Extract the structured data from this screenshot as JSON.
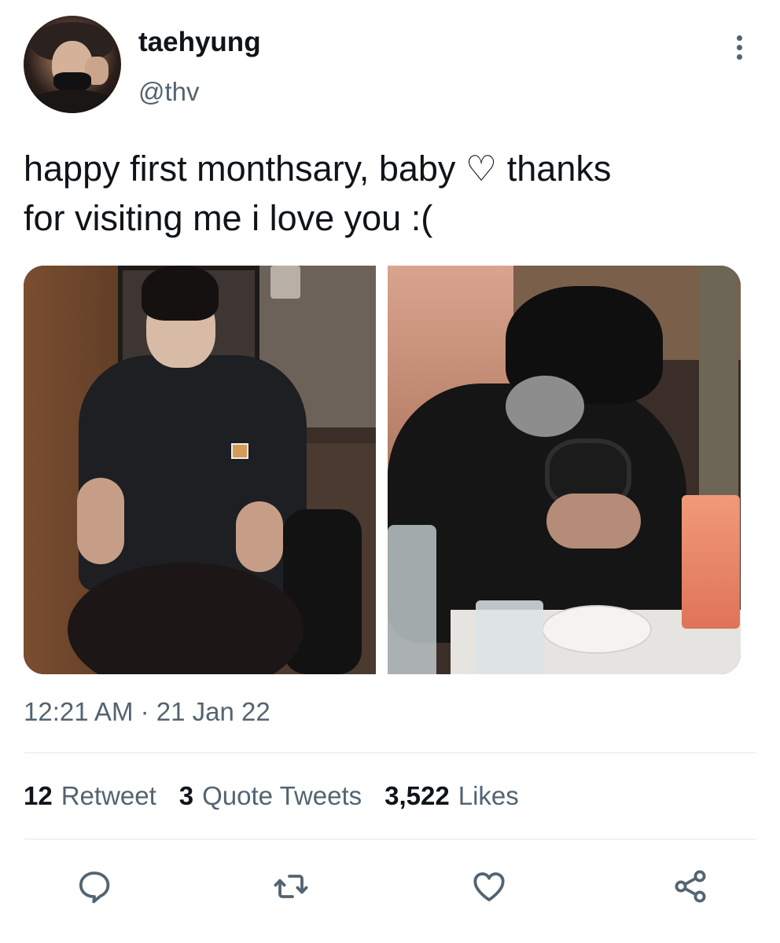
{
  "tweet": {
    "display_name": "taehyung",
    "handle": "@thv",
    "text_line1": "happy first monthsary, baby ♡ thanks",
    "text_line2": "for visiting me i love you :(",
    "timestamp": "12:21 AM · 21 Jan 22"
  },
  "stats": {
    "retweets_count": "12",
    "retweets_label": "Retweet",
    "quotes_count": "3",
    "quotes_label": "Quote Tweets",
    "likes_count": "3,522",
    "likes_label": "Likes"
  },
  "icons": {
    "more": "more-vertical-icon",
    "reply": "reply-icon",
    "retweet": "retweet-icon",
    "like": "heart-icon",
    "share": "share-icon"
  },
  "colors": {
    "text_primary": "#0f1419",
    "text_secondary": "#536471",
    "divider": "#eff3f4"
  }
}
